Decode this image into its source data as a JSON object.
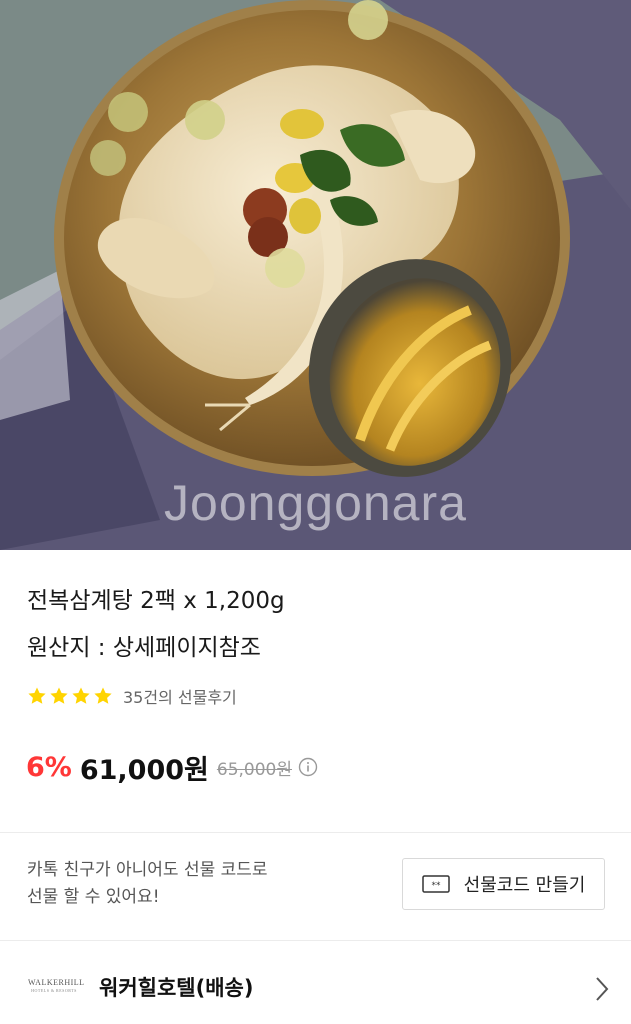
{
  "product": {
    "image_alt": "전복삼계탕",
    "watermark": "Joonggonara",
    "title": "전복삼계탕 2팩 x 1,200g",
    "origin": "원산지 : 상세페이지참조",
    "rating": 4,
    "review_count_label": "35건의 선물후기",
    "discount": "6%",
    "price": "61,000원",
    "original_price": "65,000원"
  },
  "gift": {
    "desc_line1": "카톡 친구가 아니어도 선물 코드로",
    "desc_line2": "선물 할 수 있어요!",
    "button_label": "선물코드 만들기"
  },
  "brand": {
    "logo_line1": "WALKERHILL",
    "logo_line2": "HOTELS & RESORTS",
    "name": "워커힐호텔(배송)"
  },
  "colors": {
    "discount": "#ff3737",
    "star": "#ffd400"
  },
  "icons": {
    "star": "star-icon",
    "info": "info-icon",
    "ticket": "ticket-icon",
    "chevron": "chevron-right-icon"
  }
}
